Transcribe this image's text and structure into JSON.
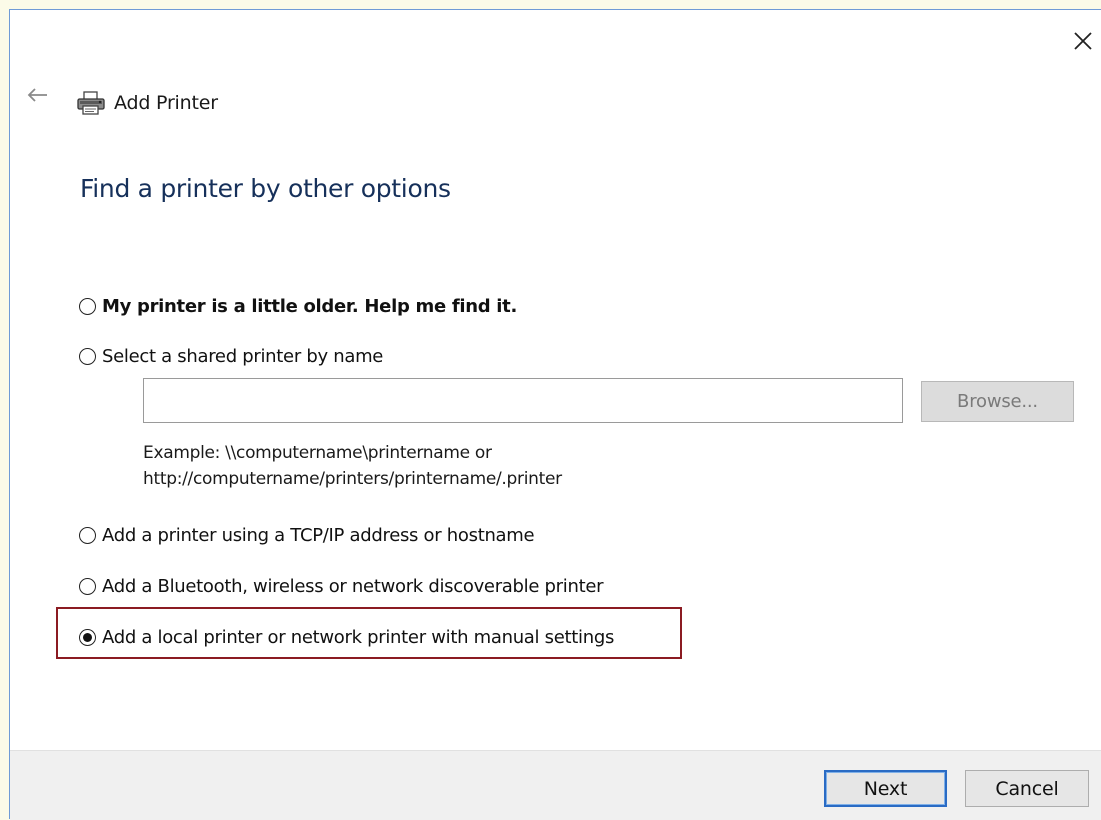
{
  "window": {
    "title": "Add Printer",
    "heading": "Find a printer by other options"
  },
  "options": [
    {
      "label": "My printer is a little older. Help me find it.",
      "selected": false
    },
    {
      "label": "Select a shared printer by name",
      "selected": false
    },
    {
      "label": "Add a printer using a TCP/IP address or hostname",
      "selected": false
    },
    {
      "label": "Add a Bluetooth, wireless or network discoverable printer",
      "selected": false
    },
    {
      "label": "Add a local printer or network printer with manual settings",
      "selected": true
    }
  ],
  "shared_printer": {
    "input_value": "",
    "browse_label": "Browse...",
    "example_line1": "Example: \\\\computername\\printername or",
    "example_line2": "http://computername/printers/printername/.printer"
  },
  "footer": {
    "next_label": "Next",
    "cancel_label": "Cancel"
  },
  "icons": {
    "close": "close-icon",
    "back": "back-arrow-icon",
    "printer": "printer-icon"
  },
  "colors": {
    "heading": "#16305a",
    "highlight": "#8b1b22",
    "default_button_border": "#2a6bc4"
  }
}
